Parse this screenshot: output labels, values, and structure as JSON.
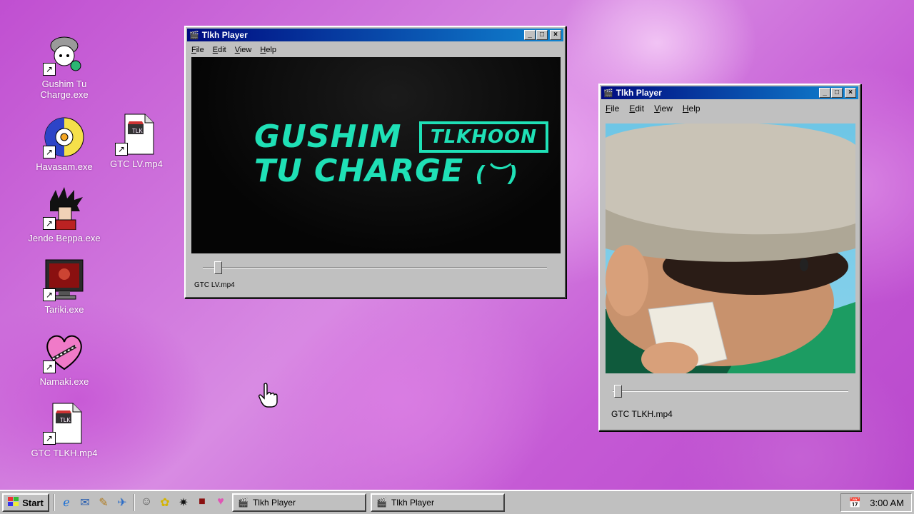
{
  "desktop_icons": [
    {
      "label": "Gushim Tu Charge.exe"
    },
    {
      "label": "Havasam.exe"
    },
    {
      "label": "GTC LV.mp4"
    },
    {
      "label": "Jende Beppa.exe"
    },
    {
      "label": "Tariki.exe"
    },
    {
      "label": "Namaki.exe"
    },
    {
      "label": "GTC TLKH.mp4"
    }
  ],
  "window_left": {
    "title": "Tlkh Player",
    "menu": [
      "File",
      "Edit",
      "View",
      "Help"
    ],
    "video_title_line1": "GUSHIM",
    "video_title_badge": "TLKHOON",
    "video_title_line2": "TU CHARGE",
    "video_title_emoticon": "(︶)",
    "file_name": "GTC LV.mp4",
    "progress": 0.04
  },
  "window_right": {
    "title": "Tlkh Player",
    "menu": [
      "File",
      "Edit",
      "View",
      "Help"
    ],
    "file_name": "GTC TLKH.mp4",
    "progress": 0.02
  },
  "taskbar": {
    "start_label": "Start",
    "tasks": [
      {
        "label": "Tlkh Player"
      },
      {
        "label": "Tlkh Player"
      }
    ],
    "clock": "3:00 AM"
  },
  "colors": {
    "title_bar": "#000a80",
    "window_face": "#c0c0c0",
    "video_text": "#1fe0b6",
    "desktop": "#d88be3"
  }
}
